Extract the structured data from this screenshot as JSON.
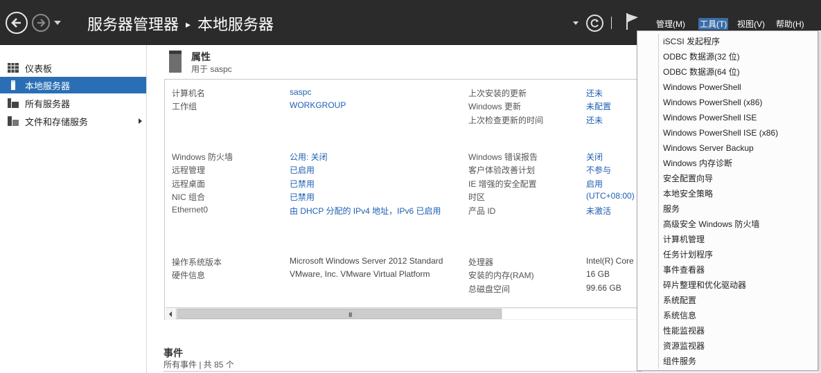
{
  "header": {
    "breadcrumb_root": "服务器管理器",
    "breadcrumb_separator": "▸",
    "breadcrumb_current": "本地服务器",
    "menus": {
      "manage": "管理(M)",
      "tools": "工具(T)",
      "view": "视图(V)",
      "help": "帮助(H)"
    },
    "separator": "|"
  },
  "sidebar": {
    "items": [
      {
        "label": "仪表板",
        "icon": "dashboard-icon"
      },
      {
        "label": "本地服务器",
        "icon": "server-icon",
        "selected": true
      },
      {
        "label": "所有服务器",
        "icon": "servers-icon"
      },
      {
        "label": "文件和存储服务",
        "icon": "storage-icon",
        "has_submenu": true
      }
    ]
  },
  "properties": {
    "title": "属性",
    "subtitle": "用于 saspc",
    "group1": {
      "computer_name_label": "计算机名",
      "computer_name_value": "saspc",
      "workgroup_label": "工作组",
      "workgroup_value": "WORKGROUP",
      "last_installed_label": "上次安装的更新",
      "last_installed_value": "还未",
      "windows_update_label": "Windows 更新",
      "windows_update_value": "未配置",
      "last_checked_label": "上次检查更新的时间",
      "last_checked_value": "还未"
    },
    "group2": {
      "firewall_label": "Windows 防火墙",
      "firewall_value": "公用: 关闭",
      "remote_mgmt_label": "远程管理",
      "remote_mgmt_value": "已启用",
      "remote_desktop_label": "远程桌面",
      "remote_desktop_value": "已禁用",
      "nic_label": "NIC 组合",
      "nic_value": "已禁用",
      "ethernet_label": "Ethernet0",
      "ethernet_value": "由 DHCP 分配的 IPv4 地址，IPv6 已启用",
      "error_report_label": "Windows 错误报告",
      "error_report_value": "关闭",
      "ceip_label": "客户体验改善计划",
      "ceip_value": "不参与",
      "ie_label": "IE 增强的安全配置",
      "ie_value": "启用",
      "timezone_label": "时区",
      "timezone_value": "(UTC+08:00)",
      "product_id_label": "产品 ID",
      "product_id_value": "未激活"
    },
    "group3": {
      "os_label": "操作系统版本",
      "os_value": "Microsoft Windows Server 2012 Standard",
      "hw_label": "硬件信息",
      "hw_value": "VMware, Inc. VMware Virtual Platform",
      "cpu_label": "处理器",
      "cpu_value": "Intel(R) Core",
      "ram_label": "安装的内存(RAM)",
      "ram_value": "16 GB",
      "disk_label": "总磁盘空间",
      "disk_value": "99.66 GB"
    },
    "scroll_grip": "III"
  },
  "events": {
    "title": "事件",
    "subtitle": "所有事件 | 共 85 个"
  },
  "tools_menu": {
    "items": [
      "iSCSI 发起程序",
      "ODBC 数据源(32 位)",
      "ODBC 数据源(64 位)",
      "Windows PowerShell",
      "Windows PowerShell (x86)",
      "Windows PowerShell ISE",
      "Windows PowerShell ISE (x86)",
      "Windows Server Backup",
      "Windows 内存诊断",
      "安全配置向导",
      "本地安全策略",
      "服务",
      "高级安全 Windows 防火墙",
      "计算机管理",
      "任务计划程序",
      "事件查看器",
      "碎片整理和优化驱动器",
      "系统配置",
      "系统信息",
      "性能监视器",
      "资源监视器",
      "组件服务"
    ]
  },
  "colors": {
    "header_bg": "#2b2b2b",
    "selected_bg": "#2a6fb5",
    "link": "#1e5fb4",
    "active_menu_bg": "#3b6ea8"
  }
}
